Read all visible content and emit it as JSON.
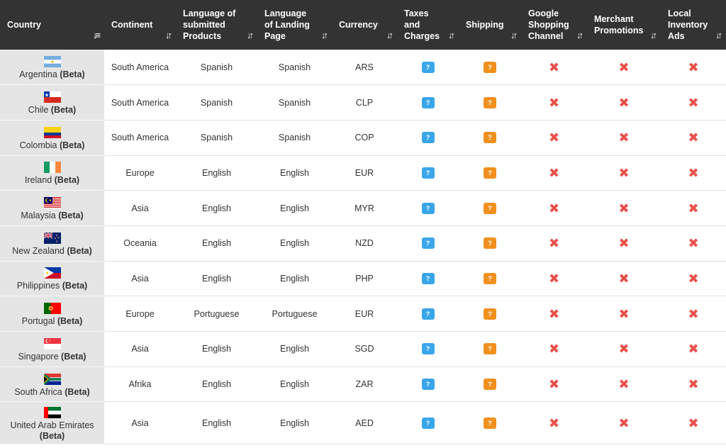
{
  "headers": [
    {
      "key": "country",
      "label": "Country",
      "sort": "active"
    },
    {
      "key": "continent",
      "label": "Continent",
      "sort": "both"
    },
    {
      "key": "language_products",
      "label": "Language of submitted Products",
      "sort": "both"
    },
    {
      "key": "language_landing",
      "label": "Language of Landing Page",
      "sort": "both"
    },
    {
      "key": "currency",
      "label": "Currency",
      "sort": "both"
    },
    {
      "key": "taxes",
      "label": "Taxes and Charges",
      "sort": "both"
    },
    {
      "key": "shipping",
      "label": "Shipping",
      "sort": "both"
    },
    {
      "key": "google_shopping",
      "label": "Google Shopping Channel",
      "sort": "both"
    },
    {
      "key": "merchant_promotions",
      "label": "Merchant Promotions",
      "sort": "both"
    },
    {
      "key": "local_inventory",
      "label": "Local Inventory Ads",
      "sort": "both"
    }
  ],
  "beta_label": "(Beta)",
  "info_icon_glyph": "?",
  "colors": {
    "header_bg": "#333333",
    "info_blue": "#3aa6ea",
    "info_orange": "#f0901e",
    "cross_red": "#e8504a",
    "country_bg": "#e5e5e5"
  },
  "rows": [
    {
      "country": "Argentina",
      "flag": "flag-ar",
      "continent": "South America",
      "language_products": "Spanish",
      "language_landing": "Spanish",
      "currency": "ARS"
    },
    {
      "country": "Chile",
      "flag": "flag-cl",
      "continent": "South America",
      "language_products": "Spanish",
      "language_landing": "Spanish",
      "currency": "CLP"
    },
    {
      "country": "Colombia",
      "flag": "flag-co",
      "continent": "South America",
      "language_products": "Spanish",
      "language_landing": "Spanish",
      "currency": "COP"
    },
    {
      "country": "Ireland",
      "flag": "flag-ie",
      "continent": "Europe",
      "language_products": "English",
      "language_landing": "English",
      "currency": "EUR"
    },
    {
      "country": "Malaysia",
      "flag": "flag-my",
      "continent": "Asia",
      "language_products": "English",
      "language_landing": "English",
      "currency": "MYR"
    },
    {
      "country": "New Zealand",
      "flag": "flag-nz",
      "continent": "Oceania",
      "language_products": "English",
      "language_landing": "English",
      "currency": "NZD"
    },
    {
      "country": "Philippines",
      "flag": "flag-ph",
      "continent": "Asia",
      "language_products": "English",
      "language_landing": "English",
      "currency": "PHP"
    },
    {
      "country": "Portugal",
      "flag": "flag-pt",
      "continent": "Europe",
      "language_products": "Portuguese",
      "language_landing": "Portuguese",
      "currency": "EUR"
    },
    {
      "country": "Singapore",
      "flag": "flag-sg",
      "continent": "Asia",
      "language_products": "English",
      "language_landing": "English",
      "currency": "SGD"
    },
    {
      "country": "South Africa",
      "flag": "flag-za",
      "continent": "Afrika",
      "language_products": "English",
      "language_landing": "English",
      "currency": "ZAR"
    },
    {
      "country": "United Arab Emirates",
      "flag": "flag-ae",
      "continent": "Asia",
      "language_products": "English",
      "language_landing": "English",
      "currency": "AED"
    }
  ]
}
